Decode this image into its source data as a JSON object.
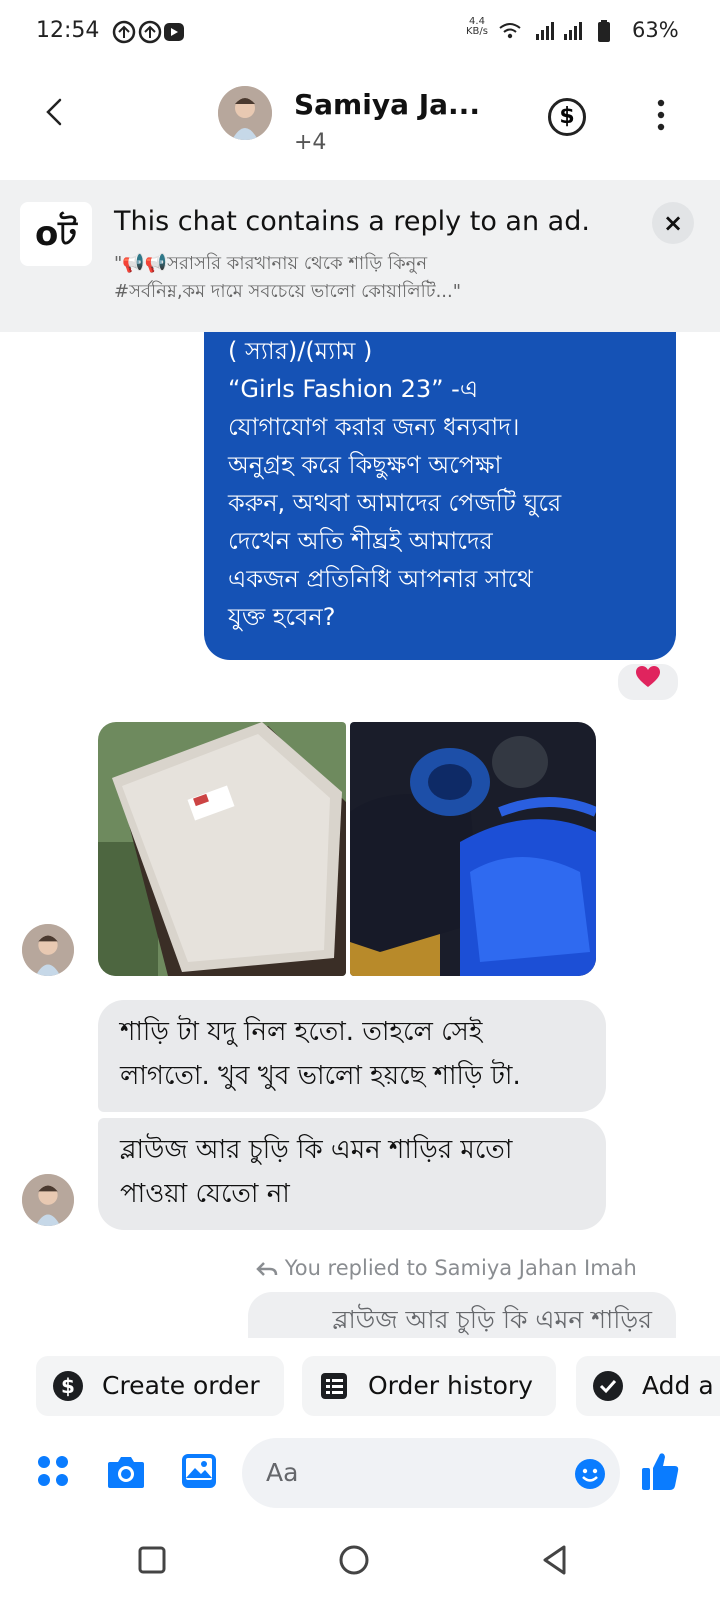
{
  "status_bar": {
    "time": "12:54",
    "net_speed_top": "4.4",
    "net_speed_unit": "KB/s",
    "battery": "63%",
    "icons": [
      "data-saver-icon",
      "data-saver-icon",
      "youtube-icon",
      "wifi-icon",
      "signal-icon",
      "signal-icon",
      "battery-icon"
    ]
  },
  "header": {
    "name": "Samiya Ja...",
    "participants": "+4",
    "currency_icon": "$"
  },
  "ad_banner": {
    "logo_text": "oট",
    "title": "This chat contains a reply to an ad.",
    "subtitle_line1": "\"📢📢সরাসরি কারখানায় থেকে শাড়ি কিনুন",
    "subtitle_line2": "#সর্বনিম্ন,কম দামে সবচেয়ে ভালো কোয়ালিটি...\"",
    "close": "×"
  },
  "messages": {
    "outgoing_text": "( স্যার)/(ম্যাম )\n  “Girls Fashion 23”  -এ\nযোগাযোগ করার জন্য ধন্যবাদ।\nঅনুগ্রহ করে কিছুক্ষণ অপেক্ষা\nকরুন, অথবা আমাদের পেজটি ঘুরে\nদেখেন  অতি শীঘ্রই  আমাদের\nএকজন প্রতিনিধি আপনার সাথে\nযুক্ত হবেন?",
    "reaction": "❤️",
    "incoming_1": "শাড়ি টা যদু নিল হতো. তাহলে সেই\nলাগতো.  খুব খুব ভালো হয়ছে শাড়ি টা.",
    "incoming_2": "ব্লাউজ আর চুড়ি কি এমন শাড়ির মতো\nপাওয়া যেতো না",
    "replied_label": "You replied to Samiya Jahan Imah",
    "reply_quote": "ব্লাউজ আর চুড়ি কি এমন শাড়ির"
  },
  "quick_actions": [
    {
      "label": "Create order",
      "icon": "dollar-icon"
    },
    {
      "label": "Order history",
      "icon": "list-icon"
    },
    {
      "label": "Add a",
      "icon": "check-icon"
    }
  ],
  "composer": {
    "placeholder": "Aa"
  },
  "colors": {
    "brand_blue": "#1552b5",
    "messenger_blue": "#0a7cff",
    "bubble_gray": "#e9eaec"
  }
}
